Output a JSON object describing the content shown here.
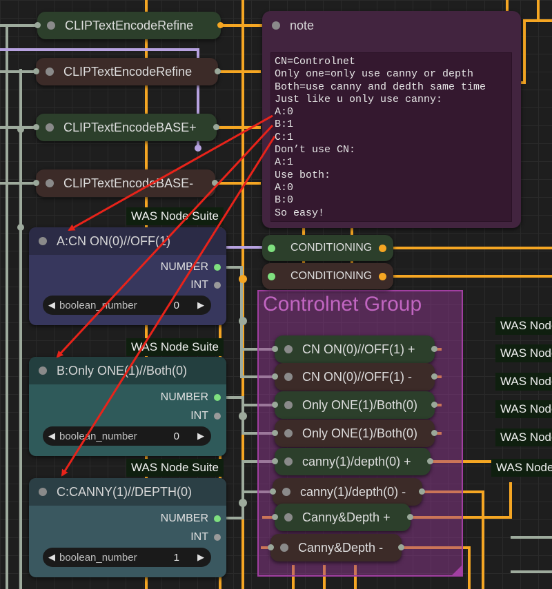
{
  "colors": {
    "canvas_bg": "#1e1e1e",
    "wire_orange": "#f5a623",
    "wire_gray": "#9eab9d",
    "wire_purple": "#b7a2e0",
    "group_border": "#a13fa1",
    "arrow_red": "#e8231a"
  },
  "top_nodes": [
    {
      "label": "CLIPTextEncodeRefine"
    },
    {
      "label": "CLIPTextEncodeRefine"
    },
    {
      "label": "CLIPTextEncodeBASE+"
    },
    {
      "label": "CLIPTextEncodeBASE-"
    }
  ],
  "note": {
    "title": "note",
    "text": "CN=Controlnet\nOnly one=only use canny or depth\nBoth=use canny and dedth same time\nJust like u only use canny:\nA:0\nB:1\nC:1\nDon’t use CN:\nA:1\nUse both:\nA:0\nB:0\nSo easy!"
  },
  "was_label": "WAS Node Suite",
  "was_right_label": "WAS Node",
  "was_right_partial": "WAS Node",
  "boolean_nodes": [
    {
      "title": "A:CN ON(0)//OFF(1)",
      "out1": "NUMBER",
      "out2": "INT",
      "widget": "boolean_number",
      "value": "0"
    },
    {
      "title": "B:Only ONE(1)//Both(0)",
      "out1": "NUMBER",
      "out2": "INT",
      "widget": "boolean_number",
      "value": "0"
    },
    {
      "title": "C:CANNY(1)//DEPTH(0)",
      "out1": "NUMBER",
      "out2": "INT",
      "widget": "boolean_number",
      "value": "1"
    }
  ],
  "conditioning": [
    {
      "label": "CONDITIONING"
    },
    {
      "label": "CONDITIONING"
    }
  ],
  "group": {
    "title": "Controlnet Group"
  },
  "group_nodes": [
    {
      "label": "CN ON(0)//OFF(1) +"
    },
    {
      "label": "CN ON(0)//OFF(1) -"
    },
    {
      "label": "Only ONE(1)/Both(0)"
    },
    {
      "label": "Only ONE(1)/Both(0)"
    },
    {
      "label": "canny(1)/depth(0) +"
    },
    {
      "label": "canny(1)/depth(0) -"
    },
    {
      "label": "Canny&Depth +"
    },
    {
      "label": "Canny&Depth -"
    }
  ],
  "icons": {
    "left_arrow": "◀",
    "right_arrow": "▶"
  }
}
